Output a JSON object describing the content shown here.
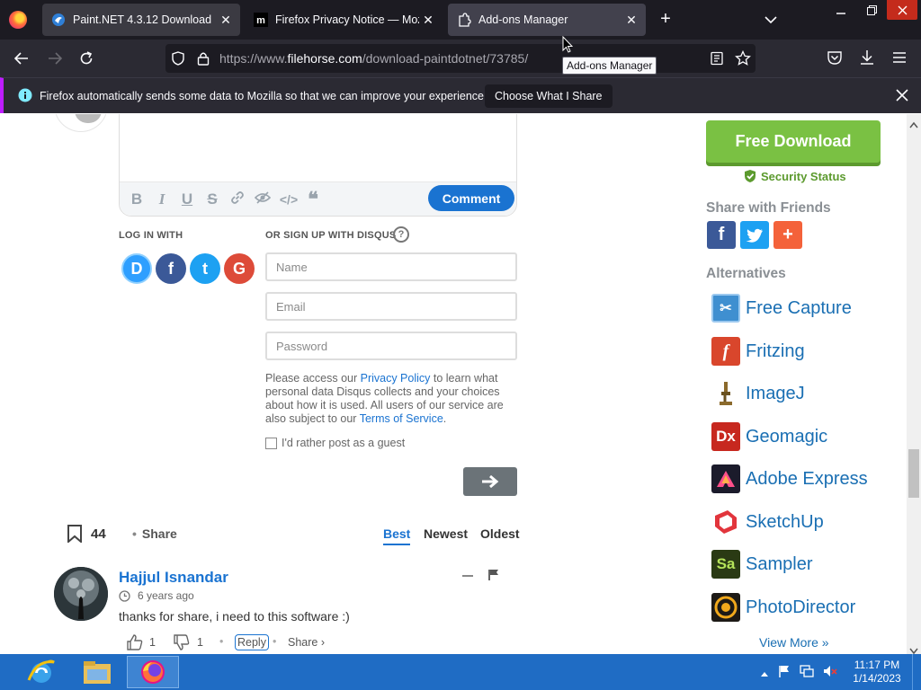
{
  "browser": {
    "tabs": [
      {
        "label": "Paint.NET 4.3.12 Download",
        "icon": "filehorse-icon"
      },
      {
        "label": "Firefox Privacy Notice — Mozilla",
        "icon": "mozilla-icon"
      },
      {
        "label": "Add-ons Manager",
        "icon": "puzzle-icon"
      }
    ],
    "url_prefix": "https://www.",
    "url_host": "filehorse.com",
    "url_path": "/download-paintdotnet/73785/",
    "tooltip": "Add-ons Manager",
    "notification": {
      "text": "Firefox automatically sends some data to Mozilla so that we can improve your experience.",
      "button": "Choose What I Share"
    }
  },
  "disqus": {
    "comment_button": "Comment",
    "login_with": "LOG IN WITH",
    "signup_with": "OR SIGN UP WITH DISQUS",
    "help": "?",
    "social": [
      "D",
      "f",
      "t",
      "G"
    ],
    "fields": {
      "name_placeholder": "Name",
      "email_placeholder": "Email",
      "password_placeholder": "Password"
    },
    "privacy": {
      "p1": "Please access our ",
      "link1": "Privacy Policy",
      "p2": " to learn what personal data Disqus collects and your choices about how it is used. All users of our service are also subject to our ",
      "link2": "Terms of Service",
      "p3": "."
    },
    "guest_label": "I'd rather post as a guest",
    "count": "44",
    "share": "Share",
    "sort": [
      "Best",
      "Newest",
      "Oldest"
    ],
    "sort_active": "Best",
    "comment": {
      "author": "Hajjul Isnandar",
      "time": "6 years ago",
      "text": "thanks for share, i need to this software :)",
      "upvotes": "1",
      "downvotes": "1",
      "reply": "Reply",
      "share": "Share ›"
    }
  },
  "sidebar": {
    "free_download": "Free Download",
    "security_status": "Security Status",
    "share_heading": "Share with Friends",
    "alternatives_heading": "Alternatives",
    "alternatives": [
      {
        "label": "Free Capture",
        "icon": "free-capture-icon",
        "color": "#3f8fd0",
        "glyph": "✂"
      },
      {
        "label": "Fritzing",
        "icon": "fritzing-icon",
        "color": "#d9462c",
        "glyph": "f"
      },
      {
        "label": "ImageJ",
        "icon": "imagej-icon",
        "color": "#ffffff",
        "glyph": "🔬"
      },
      {
        "label": "Geomagic",
        "icon": "geomagic-icon",
        "color": "#c7281f",
        "glyph": "Dx"
      },
      {
        "label": "Adobe Express",
        "icon": "adobe-express-icon",
        "color": "#1b1b2b",
        "glyph": "A"
      },
      {
        "label": "SketchUp",
        "icon": "sketchup-icon",
        "color": "#e2353c",
        "glyph": "S"
      },
      {
        "label": "Sampler",
        "icon": "sampler-icon",
        "color": "#2a3a14",
        "glyph": "Sa"
      },
      {
        "label": "PhotoDirector",
        "icon": "photodirector-icon",
        "color": "#1d1a16",
        "glyph": "◉"
      }
    ],
    "view_more": "View More »"
  },
  "taskbar": {
    "time": "11:17 PM",
    "date": "1/14/2023"
  },
  "colors": {
    "accent": "#1a73d1",
    "download_green": "#7ac143",
    "firefox_dark": "#1c1b22"
  }
}
